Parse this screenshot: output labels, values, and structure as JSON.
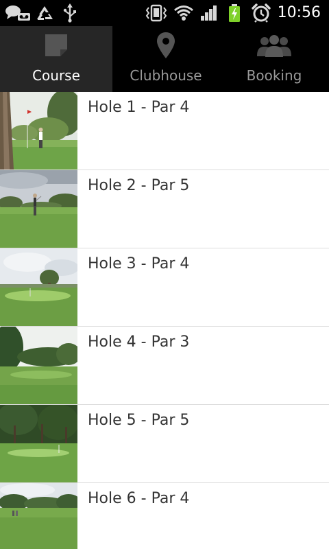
{
  "status_bar": {
    "time": "10:56",
    "icons": [
      "chat-voicemail-icon",
      "recycle-icon",
      "usb-icon",
      "vibrate-icon",
      "wifi-icon",
      "signal-icon",
      "battery-charging-icon",
      "alarm-icon"
    ],
    "battery_color": "#7fd12a"
  },
  "tabs": [
    {
      "label": "Course",
      "icon": "square-course-icon",
      "selected": true
    },
    {
      "label": "Clubhouse",
      "icon": "map-pin-icon",
      "selected": false
    },
    {
      "label": "Booking",
      "icon": "people-icon",
      "selected": false
    }
  ],
  "holes": [
    {
      "title": "Hole 1 - Par 4"
    },
    {
      "title": "Hole 2 - Par 5"
    },
    {
      "title": "Hole 3 - Par 4"
    },
    {
      "title": "Hole 4 - Par 3"
    },
    {
      "title": "Hole 5 - Par 5"
    },
    {
      "title": "Hole 6 - Par 4"
    }
  ]
}
